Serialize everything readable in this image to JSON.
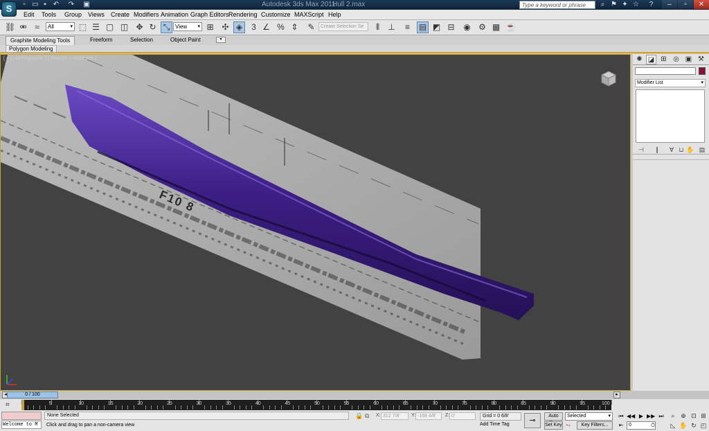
{
  "title_bar": {
    "app_name": "Autodesk 3ds Max 2011",
    "file_name": "Hull 2.max",
    "search_placeholder": "Type a keyword or phrase",
    "quick_access": [
      "new-icon",
      "open-icon",
      "save-icon",
      "undo-icon",
      "redo-icon",
      "project-folder-icon"
    ]
  },
  "menu": [
    "Edit",
    "Tools",
    "Group",
    "Views",
    "Create",
    "Modifiers",
    "Animation",
    "Graph Editors",
    "Rendering",
    "Customize",
    "MAXScript",
    "Help"
  ],
  "toolbar": {
    "selection_filter": "All",
    "reference_coord": "View",
    "named_selection_placeholder": "Create Selection Se",
    "snap_label": "3"
  },
  "ribbon": {
    "tabs": [
      "Graphite Modeling Tools",
      "Freeform",
      "Selection",
      "Object Paint"
    ],
    "panel": "Polygon Modeling"
  },
  "viewport": {
    "label": "[ + ] [ Orthographic ] [ Smooth + Highlights ]",
    "reference_text": "F10 8",
    "hull_color": "#4a2a8a",
    "accent": "#c7a42f"
  },
  "command_panel": {
    "modifier_list": "Modifier List",
    "object_color": "#8a1038"
  },
  "timeline": {
    "frame_range": "0 / 100",
    "ticks": [
      "5",
      "10",
      "15",
      "20",
      "25",
      "30",
      "35",
      "40",
      "45",
      "50",
      "55",
      "60",
      "65",
      "70",
      "75",
      "80",
      "85",
      "90",
      "95",
      "100"
    ]
  },
  "status": {
    "listener": "Welcome to M",
    "selection": "None Selected",
    "prompt": "Click and drag to pan a non-camera view",
    "x_label": "X:",
    "x_value": "312 7/8'",
    "y_label": "Y:",
    "y_value": "-168 4/8'",
    "z_label": "Z:",
    "z_value": "0'",
    "grid": "Grid = 0 6/8'",
    "add_time_tag": "Add Time Tag",
    "auto_key": "Auto Key",
    "set_key": "Set Key",
    "selected": "Selected",
    "key_filters": "Key Filters...",
    "frame": "0"
  }
}
